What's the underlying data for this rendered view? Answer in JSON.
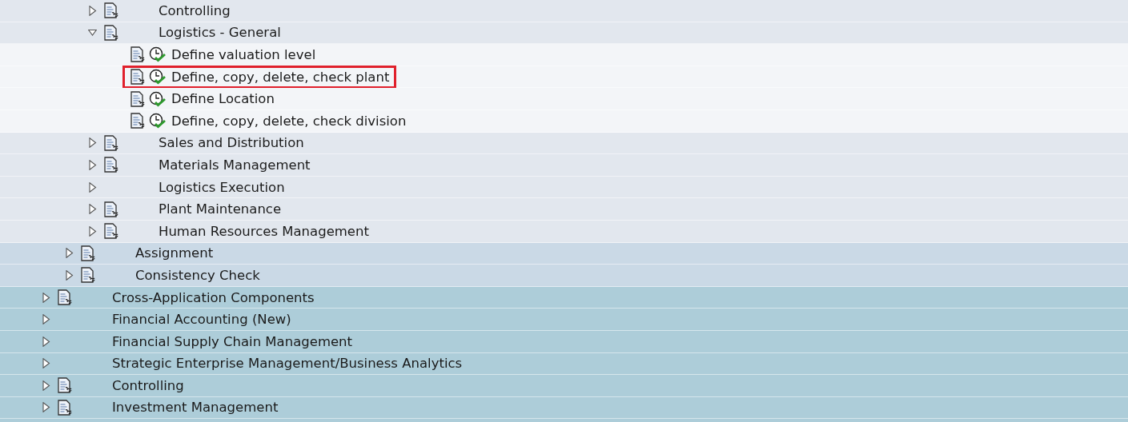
{
  "tree": {
    "items": [
      {
        "children": [
          {
            "children": [
              {
                "label": "Controlling",
                "icon": true,
                "expanded": false
              },
              {
                "label": "Logistics - General",
                "icon": true,
                "expanded": true,
                "children": [
                  {
                    "kind": "activity",
                    "label": "Define valuation level",
                    "highlighted": false
                  },
                  {
                    "kind": "activity",
                    "label": "Define, copy, delete, check plant",
                    "highlighted": true
                  },
                  {
                    "kind": "activity",
                    "label": "Define Location",
                    "highlighted": false
                  },
                  {
                    "kind": "activity",
                    "label": "Define, copy, delete, check division",
                    "highlighted": false
                  }
                ]
              },
              {
                "label": "Sales and Distribution",
                "icon": true,
                "expanded": false
              },
              {
                "label": "Materials Management",
                "icon": true,
                "expanded": false
              },
              {
                "label": "Logistics Execution",
                "icon": false,
                "expanded": false
              },
              {
                "label": "Plant Maintenance",
                "icon": true,
                "expanded": false
              },
              {
                "label": "Human Resources Management",
                "icon": true,
                "expanded": false
              }
            ]
          },
          {
            "label": "Assignment",
            "icon": true,
            "expanded": false
          },
          {
            "label": "Consistency Check",
            "icon": true,
            "expanded": false
          }
        ]
      },
      {
        "label": "Cross-Application Components",
        "icon": true,
        "expanded": false
      },
      {
        "label": "Financial Accounting (New)",
        "icon": false,
        "expanded": false
      },
      {
        "label": "Financial Supply Chain Management",
        "icon": false,
        "expanded": false
      },
      {
        "label": "Strategic Enterprise Management/Business Analytics",
        "icon": false,
        "expanded": false
      },
      {
        "label": "Controlling",
        "icon": true,
        "expanded": false
      },
      {
        "label": "Investment Management",
        "icon": true,
        "expanded": false
      }
    ]
  }
}
